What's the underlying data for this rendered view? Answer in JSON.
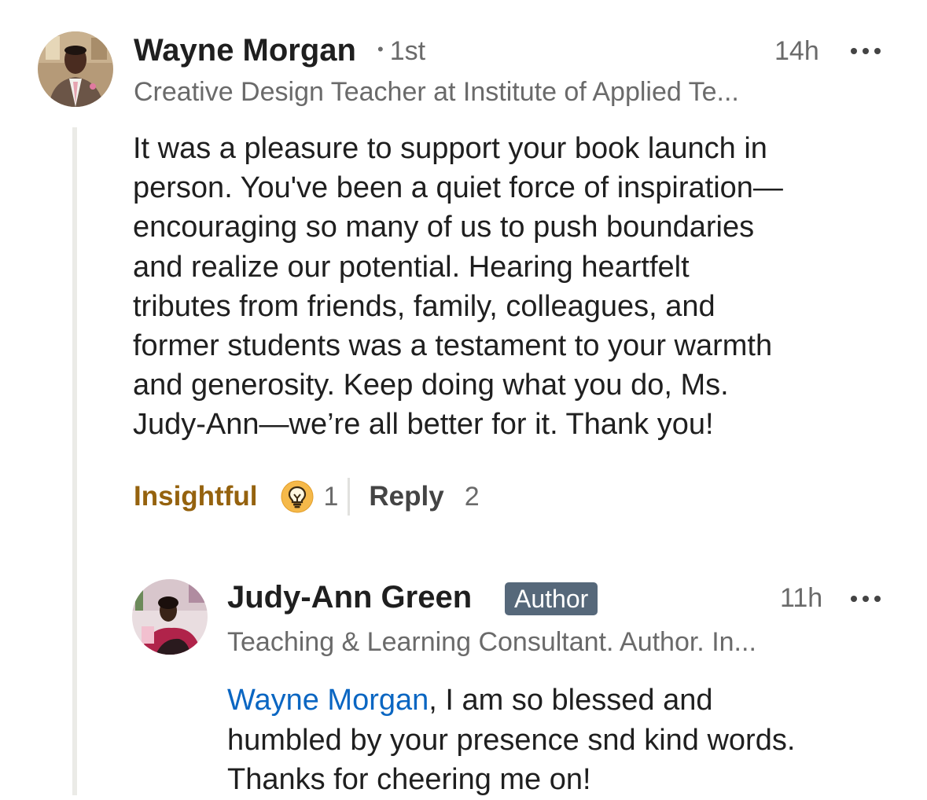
{
  "comment": {
    "author": "Wayne Morgan",
    "connection": "1st",
    "time": "14h",
    "headline": "Creative Design Teacher at Institute of Applied Te...",
    "text_lines": [
      "It was a pleasure to support your book launch in",
      "person. You've been a quiet force of inspiration—",
      "encouraging so many of us to push boundaries",
      "and realize our potential. Hearing heartfelt",
      "tributes from friends, family, colleagues, and",
      "former students was a testament to your warmth",
      "and generosity. Keep doing what you do, Ms.",
      "Judy-Ann—we’re all better for it. Thank you!"
    ],
    "reaction_label": "Insightful",
    "reaction_icon": "lightbulb-icon",
    "reaction_count": "1",
    "reply_label": "Reply",
    "reply_count": "2"
  },
  "reply": {
    "author": "Judy-Ann Green",
    "badge": "Author",
    "time": "11h",
    "headline": "Teaching & Learning Consultant. Author. In...",
    "mention": "Wayne Morgan",
    "text_lines": [
      ", I am so blessed  and",
      "humbled by your presence snd kind words.",
      "Thanks for cheering me on!"
    ]
  },
  "colors": {
    "reaction_accent": "#95620e",
    "mention_link": "#0a66c2",
    "badge_bg": "#56687a",
    "bulb_fill": "#f5b94a"
  }
}
